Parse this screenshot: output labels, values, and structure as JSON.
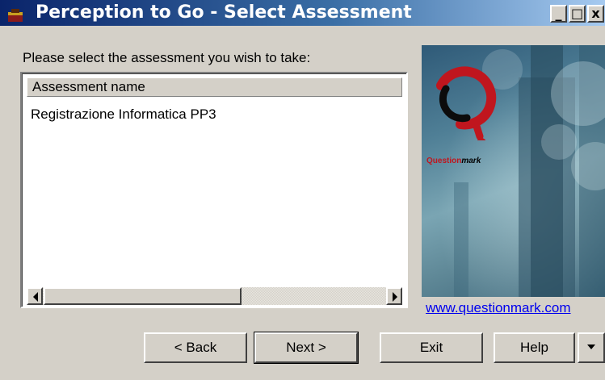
{
  "window": {
    "title": "Perception to Go - Select Assessment",
    "controls": {
      "minimize": "_",
      "maximize": "□",
      "close": "x"
    }
  },
  "prompt": "Please select the assessment you wish to take:",
  "list": {
    "column_header": "Assessment name",
    "items": [
      "Registrazione Informatica PP3"
    ]
  },
  "banner": {
    "brand_name": "Question",
    "brand_suffix": "mark",
    "accent_color": "#c0161e",
    "link": "www.questionmark.com"
  },
  "buttons": {
    "back": "< Back",
    "next": "Next >",
    "exit": "Exit",
    "help": "Help",
    "help_dropdown_icon": "chevron-down-icon"
  }
}
